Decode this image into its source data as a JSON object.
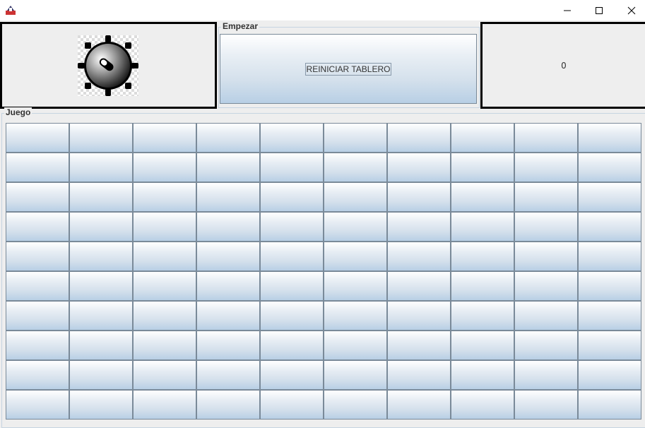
{
  "window": {
    "icon": "java-app-icon",
    "controls": [
      "minimize-icon",
      "maximize-icon",
      "close-icon"
    ]
  },
  "status_panel": {
    "icon": "mine-icon"
  },
  "counter_panel": {
    "value": "0"
  },
  "start_section": {
    "title": "Empezar",
    "reset_button": "REINICIAR TABLERO"
  },
  "game_section": {
    "title": "Juego",
    "rows": 10,
    "cols": 10
  },
  "colors": {
    "background": "#eeeeee",
    "cell_gradient_top": "#ffffff",
    "cell_gradient_bottom": "#b8cfe5",
    "border": "#000000"
  }
}
